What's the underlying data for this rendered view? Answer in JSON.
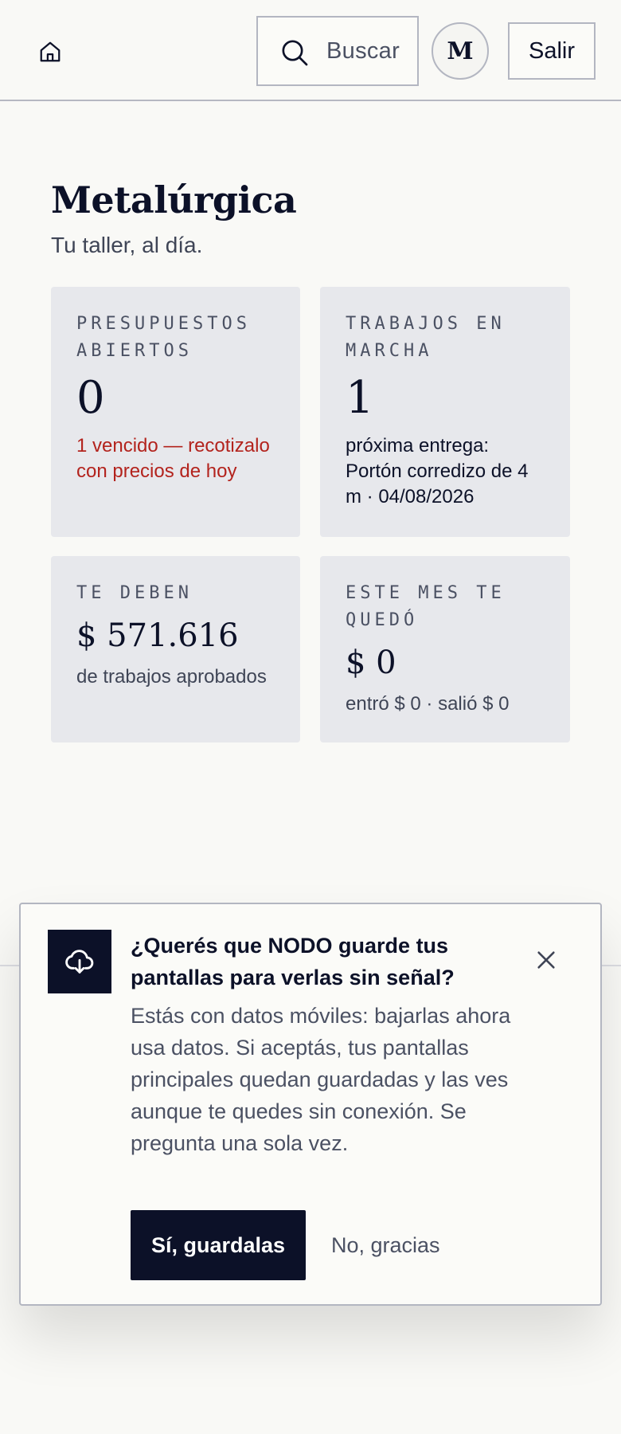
{
  "header": {
    "search_label": "Buscar",
    "avatar_initial": "M",
    "logout_label": "Salir"
  },
  "page": {
    "title": "Metalúrgica",
    "subtitle": "Tu taller, al día."
  },
  "cards": [
    {
      "caption": "PRESUPUESTOS ABIERTOS",
      "value": "0",
      "note": "1 vencido — recotizalo con precios de hoy",
      "note_color": "#b3231d"
    },
    {
      "caption": "TRABAJOS EN MARCHA",
      "value": "1",
      "note": "próxima entrega: Portón corredizo de 4 m · 04/08/2026"
    },
    {
      "caption": "TE DEBEN",
      "value": "$ 571.616",
      "note": "de trabajos aprobados"
    },
    {
      "caption": "ESTE MES TE QUEDÓ",
      "value": "$ 0",
      "note": "entró $ 0 · salió $ 0"
    }
  ],
  "offline_prompt": {
    "question": "¿Querés que NODO guarde tus pantallas para verlas sin señal?",
    "body": "Estás con datos móviles: bajarlas ahora usa datos. Si aceptás, tus pantallas principales quedan guardadas y las ves aunque te quedes sin conexión. Se pregunta una sola vez.",
    "accept_label": "Sí, guardalas",
    "decline_label": "No, gracias"
  },
  "colors": {
    "ink": "#0c1128",
    "background": "#f9f9f6",
    "card": "#e7e8ec",
    "alert": "#b3231d"
  }
}
